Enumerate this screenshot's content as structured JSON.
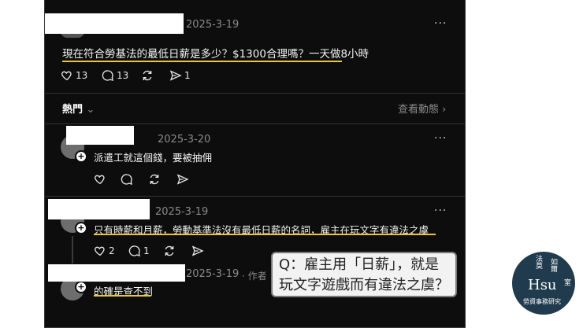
{
  "colors": {
    "panel_bg": "#0d0d0d",
    "underline": "#e8c93a",
    "logo_bg": "#1f3b4d"
  },
  "post": {
    "date": "2025-3-19",
    "more_label": "···",
    "text": "現在符合勞基法的最低日薪是多少？$1300合理嗎？一天做8小時",
    "likes": "13",
    "comments": "13",
    "shares": "1"
  },
  "replies_header": {
    "sort_label": "熱門",
    "view_activity": "查看動態"
  },
  "comments": [
    {
      "date": "2025-3-20",
      "text": "派遣工就這個錢，要被抽佣",
      "more_label": "···"
    },
    {
      "date": "2025-3-19",
      "text": "只有時薪和月薪，勞動基準法沒有最低日薪的名詞，雇主在玩文字有違法之虞",
      "likes": "2",
      "comments": "1",
      "more_label": "···"
    },
    {
      "date": "2025-3-19",
      "author_label": "作者",
      "text": "的確是查不到",
      "more_label": "···"
    }
  ],
  "callout": {
    "line1": "Q：雇主用「日薪」，就是",
    "line2": "玩文字遊戲而有違法之虞？"
  },
  "logo": {
    "top_left": "法莫",
    "top_right": "如爾",
    "name": "Hsu",
    "side": "室",
    "bottom": "勞資事務研究"
  }
}
